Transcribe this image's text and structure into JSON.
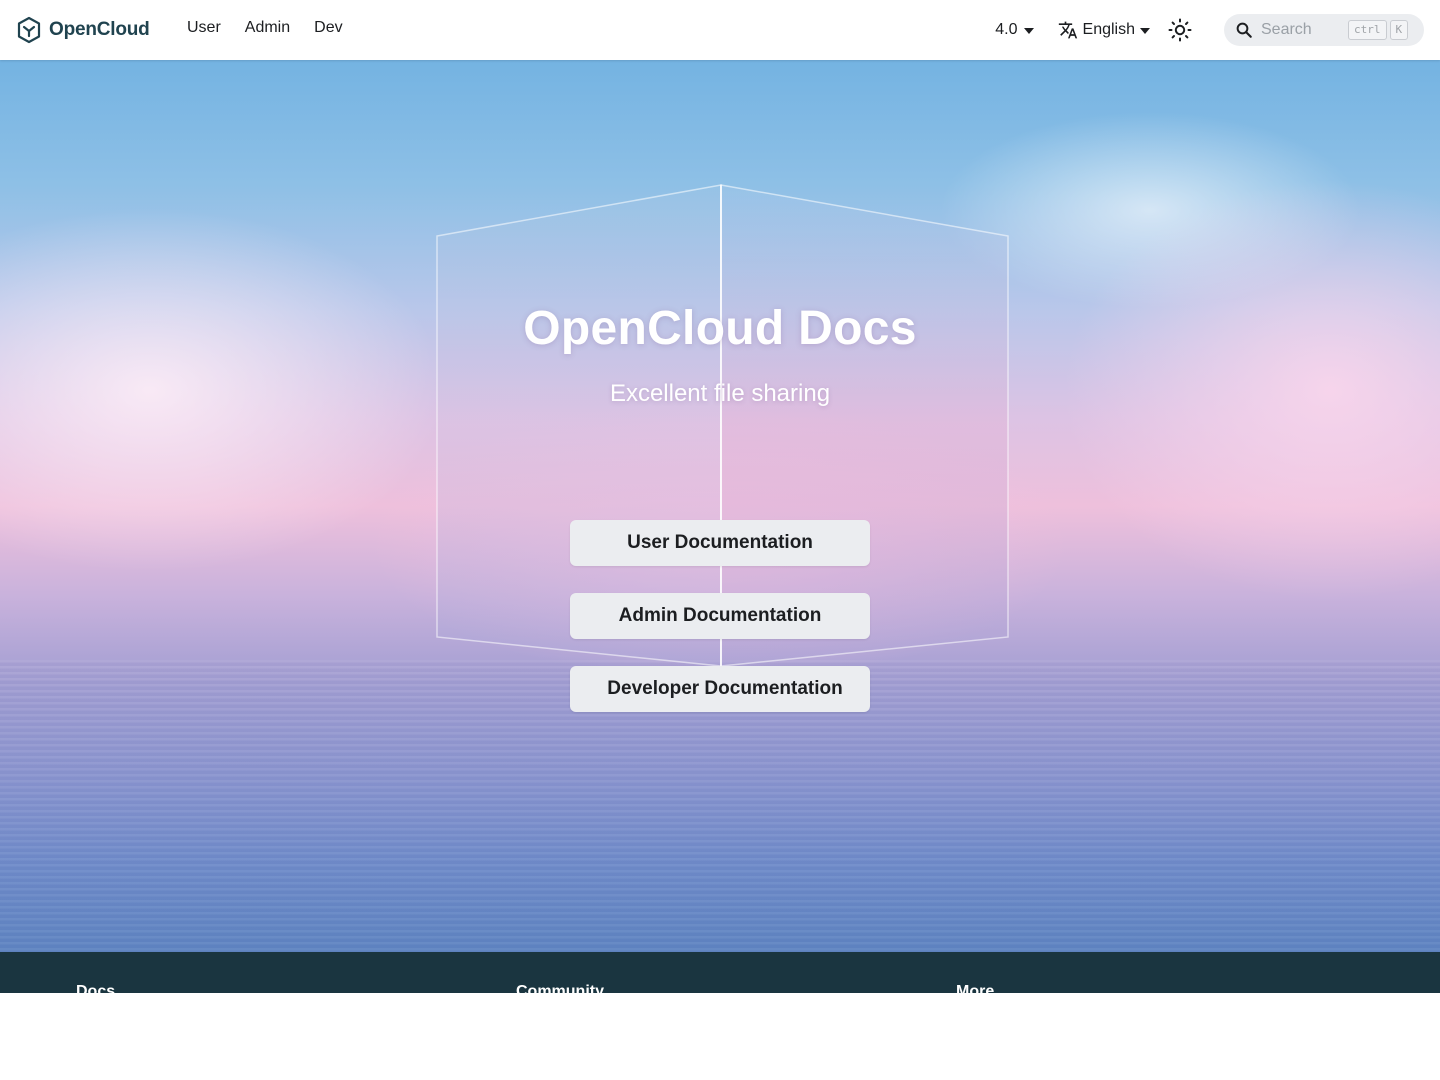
{
  "navbar": {
    "brand": "OpenCloud",
    "links": [
      {
        "label": "User"
      },
      {
        "label": "Admin"
      },
      {
        "label": "Dev"
      }
    ],
    "version": "4.0",
    "language": "English",
    "search": {
      "placeholder": "Search",
      "shortcut_keys": [
        "ctrl",
        "K"
      ]
    },
    "icons": {
      "logo": "opencloud-logo-icon",
      "language": "translate-icon",
      "theme": "sun-icon",
      "search": "search-icon"
    }
  },
  "hero": {
    "title": "OpenCloud Docs",
    "subtitle": "Excellent file sharing",
    "buttons": [
      {
        "label": "User Documentation"
      },
      {
        "label": "Admin Documentation"
      },
      {
        "label": "Developer Documentation"
      }
    ]
  },
  "footer": {
    "columns": [
      {
        "title": "Docs"
      },
      {
        "title": "Community"
      },
      {
        "title": "More"
      }
    ]
  },
  "colors": {
    "brand": "#20434f",
    "footer_bg": "#1a3540",
    "button_bg": "#ebedf0"
  }
}
